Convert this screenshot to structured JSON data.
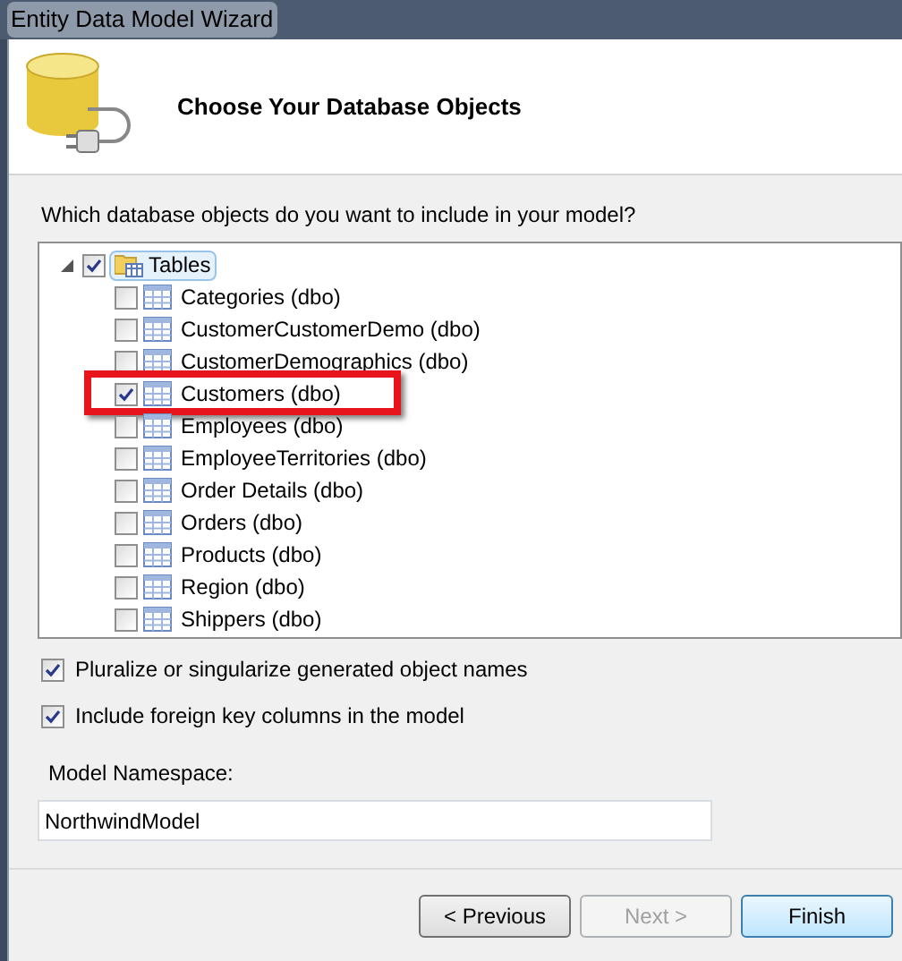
{
  "window": {
    "title": "Entity Data Model Wizard"
  },
  "header": {
    "title": "Choose Your Database Objects"
  },
  "question": "Which database objects do you want to include in your model?",
  "tree": {
    "label": "Tables",
    "checked": true,
    "expanded": true,
    "selected": true,
    "children": [
      {
        "label": "Categories (dbo)",
        "checked": false,
        "highlighted": false
      },
      {
        "label": "CustomerCustomerDemo (dbo)",
        "checked": false,
        "highlighted": false
      },
      {
        "label": "CustomerDemographics (dbo)",
        "checked": false,
        "highlighted": false
      },
      {
        "label": "Customers (dbo)",
        "checked": true,
        "highlighted": true
      },
      {
        "label": "Employees (dbo)",
        "checked": false,
        "highlighted": false
      },
      {
        "label": "EmployeeTerritories (dbo)",
        "checked": false,
        "highlighted": false
      },
      {
        "label": "Order Details (dbo)",
        "checked": false,
        "highlighted": false
      },
      {
        "label": "Orders (dbo)",
        "checked": false,
        "highlighted": false
      },
      {
        "label": "Products (dbo)",
        "checked": false,
        "highlighted": false
      },
      {
        "label": "Region (dbo)",
        "checked": false,
        "highlighted": false
      },
      {
        "label": "Shippers (dbo)",
        "checked": false,
        "highlighted": false
      }
    ]
  },
  "options": [
    {
      "label": "Pluralize or singularize generated object names",
      "checked": true
    },
    {
      "label": "Include foreign key columns in the model",
      "checked": true
    }
  ],
  "namespace": {
    "label": "Model Namespace:",
    "value": "NorthwindModel"
  },
  "buttons": [
    {
      "label": "< Previous",
      "disabled": false,
      "default": false
    },
    {
      "label": "Next >",
      "disabled": true,
      "default": false
    },
    {
      "label": "Finish",
      "disabled": false,
      "default": true
    }
  ]
}
